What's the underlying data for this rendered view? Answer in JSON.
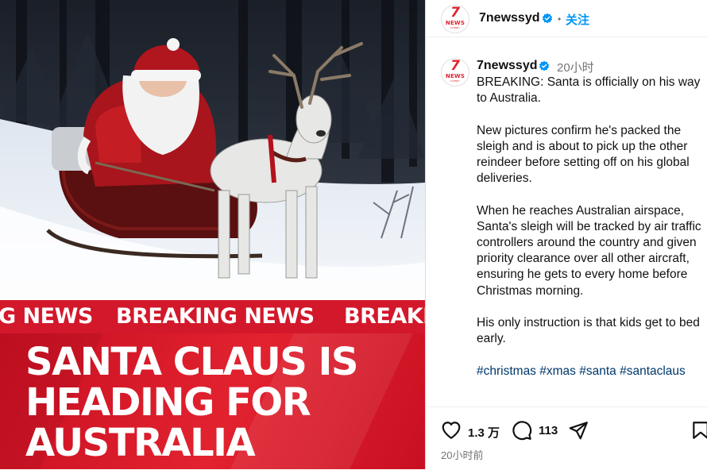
{
  "media": {
    "ticker_items": [
      "G NEWS",
      "BREAKING NEWS",
      "BREAKING NEWS"
    ],
    "headline_lines": [
      "SANTA CLAUS IS",
      "HEADING FOR",
      "AUSTRALIA"
    ]
  },
  "account": {
    "avatar_text": "7",
    "avatar_sub": "NEWS",
    "avatar_city": "SYDNEY",
    "username": "7newssyd",
    "follow_label": "关注",
    "separator": "•"
  },
  "caption": {
    "username": "7newssyd",
    "time": "20小时",
    "paragraphs": [
      "BREAKING: Santa is officially on his way to Australia.",
      "New pictures confirm he's packed the sleigh and is about to pick up the other reindeer before setting off on his global deliveries.",
      "When he reaches Australian airspace, Santa's sleigh will be tracked by air traffic controllers around the country and given priority clearance over all other aircraft, ensuring he gets to every home before Christmas morning.",
      "His only instruction is that kids get to bed early."
    ],
    "hashtags": [
      "#christmas",
      "#xmas",
      "#santa",
      "#santaclaus"
    ]
  },
  "actions": {
    "likes": "1.3 万",
    "comments": "113",
    "post_time": "20小时前"
  },
  "icons": [
    "heart-icon",
    "comment-icon",
    "share-icon",
    "bookmark-icon",
    "verified-icon"
  ],
  "colors": {
    "accent": "#0095f6",
    "hashtag": "#00376b",
    "brand_red": "#e2222f",
    "muted": "#737373"
  }
}
